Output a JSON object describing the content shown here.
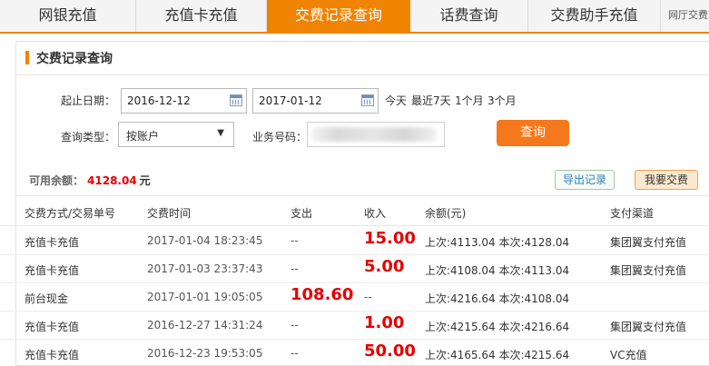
{
  "tabs": [
    {
      "label": "网银充值",
      "active": false
    },
    {
      "label": "充值卡充值",
      "active": false
    },
    {
      "label": "交费记录查询",
      "active": true
    },
    {
      "label": "话费查询",
      "active": false
    },
    {
      "label": "交费助手充值",
      "active": false
    },
    {
      "label": "网厅交费",
      "active": false
    }
  ],
  "panel": {
    "title": "交费记录查询"
  },
  "form": {
    "date_label": "起止日期：",
    "start_date": "2016-12-12",
    "end_date": "2017-01-12",
    "quick_ranges": [
      "今天",
      "最近7天",
      "1个月",
      "3个月"
    ],
    "type_label": "查询类型：",
    "type_value": "按账户",
    "biz_label": "业务号码：",
    "query_button": "查询"
  },
  "balance": {
    "label": "可用余额：",
    "value": "4128.04",
    "unit": "元"
  },
  "actions": {
    "export": "导出记录",
    "pay": "我要交费"
  },
  "table": {
    "headers": [
      "交费方式/交易单号",
      "交费时间",
      "支出",
      "收入",
      "余额(元)",
      "支付渠道"
    ],
    "rows": [
      {
        "method": "充值卡充值",
        "time": "2017-01-04 18:23:45",
        "expense": "--",
        "income": "15.00",
        "balance": "上次:4113.04 本次:4128.04",
        "channel": "集团翼支付充值"
      },
      {
        "method": "充值卡充值",
        "time": "2017-01-03 23:37:43",
        "expense": "--",
        "income": "5.00",
        "balance": "上次:4108.04 本次:4113.04",
        "channel": "集团翼支付充值"
      },
      {
        "method": "前台现金",
        "time": "2017-01-01 19:05:05",
        "expense": "108.60",
        "income": "--",
        "balance": "上次:4216.64 本次:4108.04",
        "channel": ""
      },
      {
        "method": "充值卡充值",
        "time": "2016-12-27 14:31:24",
        "expense": "--",
        "income": "1.00",
        "balance": "上次:4215.64 本次:4216.64",
        "channel": "集团翼支付充值"
      },
      {
        "method": "充值卡充值",
        "time": "2016-12-23 19:53:05",
        "expense": "--",
        "income": "50.00",
        "balance": "上次:4165.64 本次:4215.64",
        "channel": "VC充值"
      }
    ]
  },
  "colors": {
    "accent": "#f08300",
    "button": "#f6781c",
    "amount": "#e60000"
  }
}
